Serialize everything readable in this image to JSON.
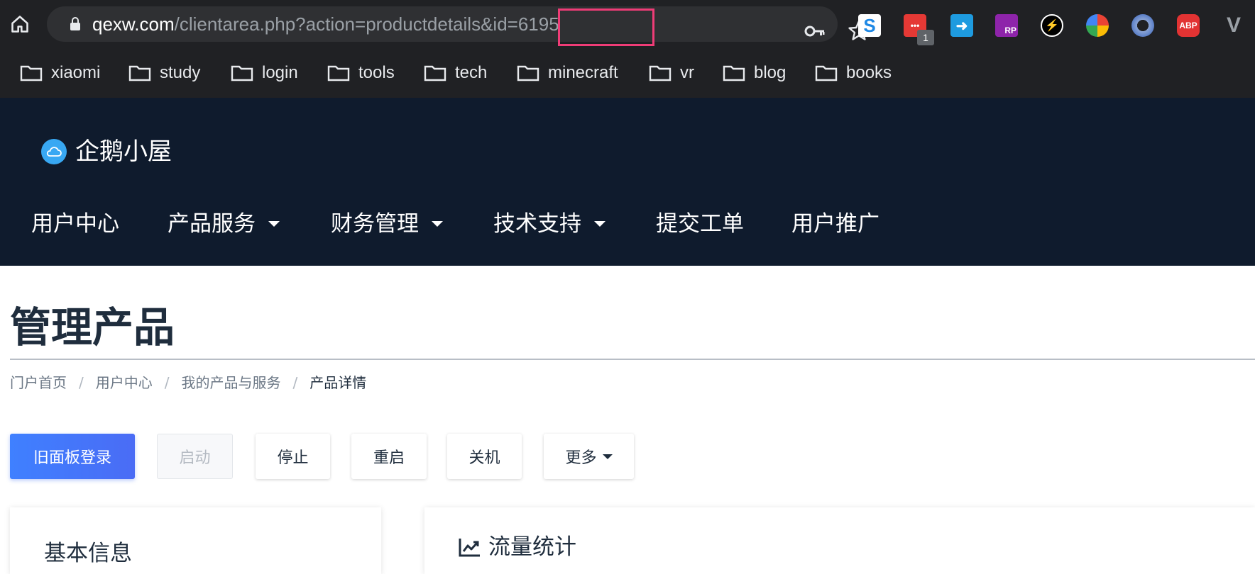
{
  "browser": {
    "url_host": "qexw.com",
    "url_path": "/clientarea.php?action=productdetails&id=6195",
    "extensions": [
      {
        "name": "s-icon",
        "label": "S",
        "color": "#ffffff"
      },
      {
        "name": "more-dots-icon",
        "label": "•••",
        "color": "#e53935"
      },
      {
        "name": "arrow-share-icon",
        "label": "➜",
        "color": "#1e9be0"
      },
      {
        "name": "rp-icon",
        "label": "RP",
        "color": "#8e24aa"
      },
      {
        "name": "lightning-icon",
        "label": "⚡",
        "color": "#000000"
      },
      {
        "name": "compass-icon",
        "label": "",
        "color": "#34a853"
      },
      {
        "name": "circle-arrows-icon",
        "label": "",
        "color": "#5b7fc7"
      },
      {
        "name": "abp-icon",
        "label": "ABP",
        "color": "#e23333"
      },
      {
        "name": "v-icon",
        "label": "V",
        "color": "#9aa0a6"
      }
    ],
    "extension_badge": "1",
    "bookmarks": [
      "xiaomi",
      "study",
      "login",
      "tools",
      "tech",
      "minecraft",
      "vr",
      "blog",
      "books"
    ]
  },
  "site": {
    "logo_text": "企鹅小屋",
    "nav": [
      {
        "label": "用户中心",
        "dropdown": false
      },
      {
        "label": "产品服务",
        "dropdown": true
      },
      {
        "label": "财务管理",
        "dropdown": true
      },
      {
        "label": "技术支持",
        "dropdown": true
      },
      {
        "label": "提交工单",
        "dropdown": false
      },
      {
        "label": "用户推广",
        "dropdown": false
      }
    ]
  },
  "page": {
    "title": "管理产品",
    "breadcrumb": [
      "门户首页",
      "用户中心",
      "我的产品与服务",
      "产品详情"
    ],
    "actions": {
      "old_panel_login": "旧面板登录",
      "start": "启动",
      "stop": "停止",
      "restart": "重启",
      "shutdown": "关机",
      "more": "更多"
    },
    "basic_info_title": "基本信息",
    "traffic_stats_title": "流量统计"
  },
  "colors": {
    "header_bg": "#0f1b2d",
    "primary": "#3f80ff",
    "url_highlight": "#ef3c77"
  }
}
